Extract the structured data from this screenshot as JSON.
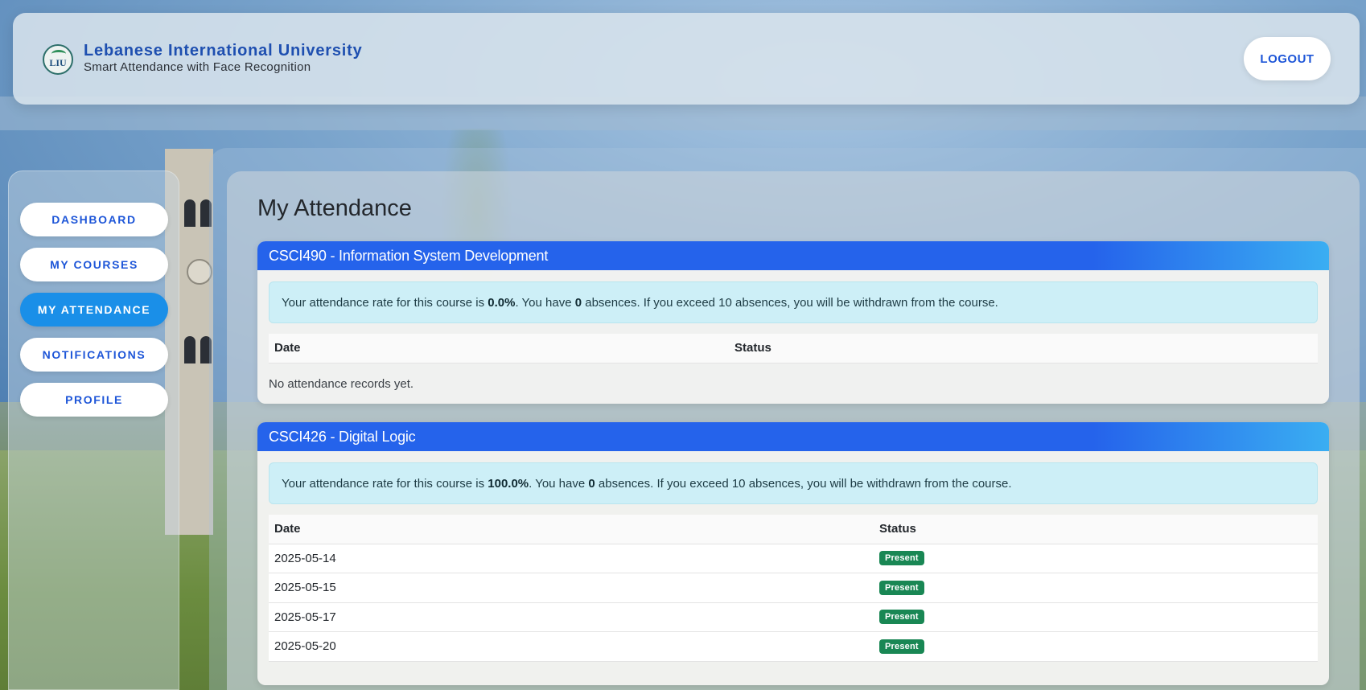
{
  "header": {
    "logo_text": "LIU",
    "title": "Lebanese International University",
    "subtitle": "Smart Attendance with Face Recognition",
    "logout_label": "LOGOUT"
  },
  "sidebar": {
    "items": [
      {
        "label": "DASHBOARD",
        "active": false
      },
      {
        "label": "MY COURSES",
        "active": false
      },
      {
        "label": "MY ATTENDANCE",
        "active": true
      },
      {
        "label": "NOTIFICATIONS",
        "active": false
      },
      {
        "label": "PROFILE",
        "active": false
      }
    ]
  },
  "main": {
    "page_title": "My Attendance",
    "courses": [
      {
        "title": "CSCI490 - Information System Development",
        "alert": {
          "prefix": "Your attendance rate for this course is ",
          "rate": "0.0%",
          "mid": ". You have ",
          "absences": "0",
          "suffix": " absences. If you exceed 10 absences, you will be withdrawn from the course."
        },
        "columns": {
          "date": "Date",
          "status": "Status"
        },
        "empty_message": "No attendance records yet.",
        "records": []
      },
      {
        "title": "CSCI426 - Digital Logic",
        "alert": {
          "prefix": "Your attendance rate for this course is ",
          "rate": "100.0%",
          "mid": ". You have ",
          "absences": "0",
          "suffix": " absences. If you exceed 10 absences, you will be withdrawn from the course."
        },
        "columns": {
          "date": "Date",
          "status": "Status"
        },
        "records": [
          {
            "date": "2025-05-14",
            "status": "Present"
          },
          {
            "date": "2025-05-15",
            "status": "Present"
          },
          {
            "date": "2025-05-17",
            "status": "Present"
          },
          {
            "date": "2025-05-20",
            "status": "Present"
          }
        ]
      }
    ]
  },
  "colors": {
    "primary": "#1e56d8",
    "active_nav": "#1a8fe8",
    "card_header": "#2563eb",
    "alert_bg": "#cdeff7",
    "present_badge": "#198754"
  }
}
